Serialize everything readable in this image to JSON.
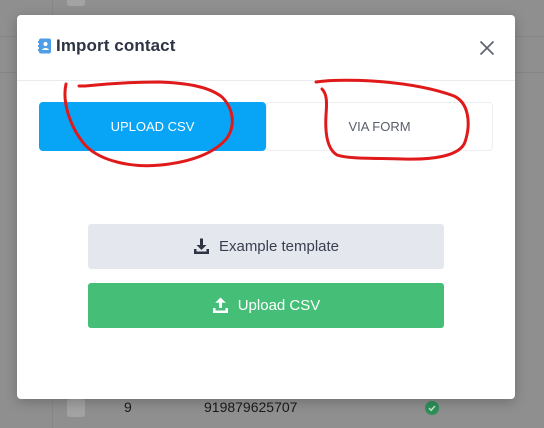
{
  "modal": {
    "title": "Import contact",
    "title_icon": "contact-book-icon",
    "close_icon": "close-icon"
  },
  "tabs": [
    {
      "label": "UPLOAD CSV",
      "active": true
    },
    {
      "label": "VIA FORM",
      "active": false
    }
  ],
  "actions": {
    "template_label": "Example template",
    "template_icon": "download-icon",
    "upload_label": "Upload CSV",
    "upload_icon": "upload-icon"
  },
  "background_row": {
    "number": "9",
    "phone": "919879625707",
    "status_icon": "check-circle-icon"
  },
  "colors": {
    "active_tab": "#08a5f7",
    "upload_button": "#45bf78",
    "template_button": "#e5e7ee",
    "annotation": "#e01a1a",
    "backdrop": "#8f8f8f"
  }
}
